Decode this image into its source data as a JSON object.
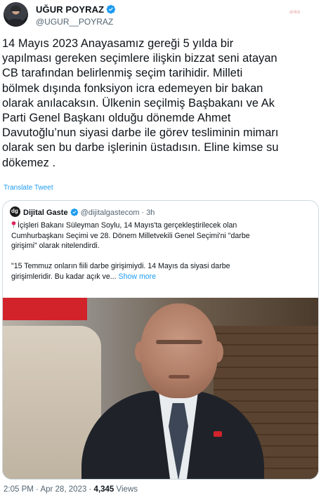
{
  "author": {
    "name": "UĞUR POYRAZ",
    "handle": "@UGUR__POYRAZ",
    "avatar_icon": "profile-photo",
    "verified_icon": "verified-badge-icon"
  },
  "watermark": "anka",
  "tweet": {
    "text": "14 Mayıs 2023 Anayasamız gereği 5 yılda bir\nyapılması gereken seçimlere ilişkin bizzat seni atayan\nCB tarafından belirlenmiş seçim tarihidir. Milleti\nbölmek dışında fonksiyon icra edemeyen bir bakan\nolarak anılacaksın. Ülkenin seçilmiş Başbakanı ve Ak\nParti Genel Başkanı olduğu dönemde Ahmet\nDavutoğlu’nun siyasi darbe ile görev tesliminin mimarı\nolarak sen bu darbe işlerinin üstadısın. Eline kimse su\ndökemez .",
    "translate_label": "Translate Tweet"
  },
  "quoted": {
    "name": "Dijital Gaste",
    "handle": "@dijitalgastecom",
    "separator": "·",
    "time": "3h",
    "text_line1": "İçişleri Bakanı Süleyman Soylu, 14 Mayıs'ta gerçekleştirilecek olan\nCumhurbaşkanı Seçimi ve 28. Dönem Milletvekili Genel Seçimi'ni \"darbe\ngirişimi\" olarak nitelendirdi.",
    "text_line2": "\"15 Temmuz onların fiili darbe girişimiydi. 14 Mayıs da siyasi darbe\ngirişimleridir. Bu kadar açık ve...",
    "show_more": "Show more",
    "pin_icon": "round-pushpin-icon",
    "image_alt": "photo of a man in a dark suit"
  },
  "footer": {
    "time": "2:05 PM",
    "separator": "·",
    "date": "Apr 28, 2023",
    "views_count": "4,345",
    "views_label": "Views"
  },
  "colors": {
    "link": "#1d9bf0",
    "secondary_text": "#536471",
    "border": "#cfd9de"
  }
}
